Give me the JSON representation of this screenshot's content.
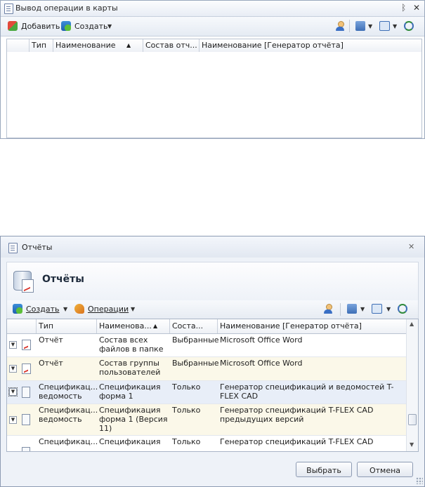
{
  "panel1": {
    "title": "Вывод операции в карты",
    "pin_glyph": "ᛒ",
    "close_glyph": "✕",
    "toolbar": {
      "add_label": "Добавить",
      "create_label": "Создать"
    },
    "columns": [
      "Тип",
      "Наименование",
      "Состав отч...",
      "Наименование [Генератор отчёта]"
    ]
  },
  "dialog": {
    "title": "Отчёты",
    "close_glyph": "✕",
    "header_title": "Отчёты",
    "toolbar": {
      "create_label": "Создать",
      "operations_label": "Операции"
    },
    "columns": [
      "Тип",
      "Наименова...",
      "Соста...",
      "Наименование [Генератор отчёта]"
    ],
    "rows": [
      {
        "type": "Отчёт",
        "name": "Состав всех файлов в папке",
        "composition": "Выбранные",
        "generator": "Microsoft Office Word",
        "selected": false
      },
      {
        "type": "Отчёт",
        "name": "Состав группы пользователей",
        "composition": "Выбранные",
        "generator": "Microsoft Office Word",
        "selected": false
      },
      {
        "type": "Спецификац... ведомость",
        "name": "Спецификация форма 1",
        "composition": "Только",
        "generator": "Генератор спецификаций и ведомостей T-FLEX CAD",
        "selected": true
      },
      {
        "type": "Спецификац... ведомость",
        "name": "Спецификация форма 1 (Версия 11)",
        "composition": "Только",
        "generator": "Генератор спецификаций T-FLEX CAD предыдущих версий",
        "selected": false
      },
      {
        "type": "Спецификац...",
        "name": "Спецификация",
        "composition": "Только",
        "generator": "Генератор спецификаций T-FLEX CAD",
        "selected": false
      }
    ],
    "buttons": {
      "select_label": "Выбрать",
      "cancel_label": "Отмена"
    },
    "colors": {
      "row_alt": "#fbf8e9",
      "row_selected": "#e8eef8",
      "accent": "#3e6fb6"
    }
  }
}
